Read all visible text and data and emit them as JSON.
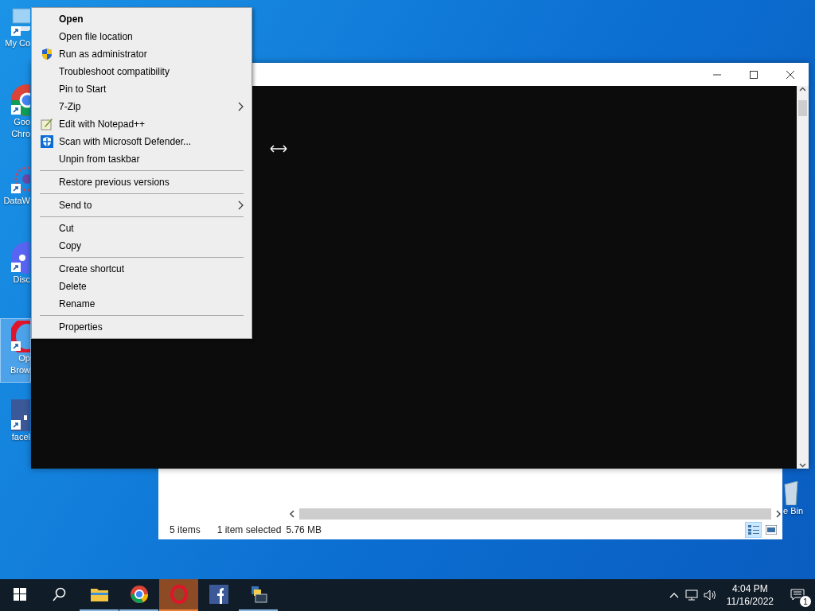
{
  "desktop_icons": [
    {
      "lines": [
        "My Co"
      ],
      "selected": false
    },
    {
      "lines": [
        "Goo",
        "Chro"
      ],
      "selected": false
    },
    {
      "lines": [
        "DataW"
      ],
      "selected": false
    },
    {
      "lines": [
        "Disc"
      ],
      "selected": false
    },
    {
      "lines": [
        "Op",
        "Brow"
      ],
      "selected": true
    },
    {
      "lines": [
        "facel"
      ],
      "selected": false
    }
  ],
  "recycle_bin": {
    "label": "e Bin"
  },
  "context_menu": {
    "items": [
      {
        "kind": "item",
        "label": "Open",
        "default": true,
        "submenu": false
      },
      {
        "kind": "item",
        "label": "Open file location",
        "default": false,
        "submenu": false
      },
      {
        "kind": "item",
        "label": "Run as administrator",
        "default": false,
        "submenu": false
      },
      {
        "kind": "item",
        "label": "Troubleshoot compatibility",
        "default": false,
        "submenu": false
      },
      {
        "kind": "item",
        "label": "Pin to Start",
        "default": false,
        "submenu": false
      },
      {
        "kind": "item",
        "label": "7-Zip",
        "default": false,
        "submenu": true
      },
      {
        "kind": "item",
        "label": "Edit with Notepad++",
        "default": false,
        "submenu": false
      },
      {
        "kind": "item",
        "label": "Scan with Microsoft Defender...",
        "default": false,
        "submenu": false
      },
      {
        "kind": "item",
        "label": "Unpin from taskbar",
        "default": false,
        "submenu": false
      },
      {
        "kind": "separator"
      },
      {
        "kind": "item",
        "label": "Restore previous versions",
        "default": false,
        "submenu": false
      },
      {
        "kind": "separator"
      },
      {
        "kind": "item",
        "label": "Send to",
        "default": false,
        "submenu": true
      },
      {
        "kind": "separator"
      },
      {
        "kind": "item",
        "label": "Cut",
        "default": false,
        "submenu": false
      },
      {
        "kind": "item",
        "label": "Copy",
        "default": false,
        "submenu": false
      },
      {
        "kind": "separator"
      },
      {
        "kind": "item",
        "label": "Create shortcut",
        "default": false,
        "submenu": false
      },
      {
        "kind": "item",
        "label": "Delete",
        "default": false,
        "submenu": false
      },
      {
        "kind": "item",
        "label": "Rename",
        "default": false,
        "submenu": false
      },
      {
        "kind": "separator"
      },
      {
        "kind": "item",
        "label": "Properties",
        "default": false,
        "submenu": false
      }
    ]
  },
  "explorer": {
    "status": [
      "5 items",
      "1 item selected",
      "5.76 MB"
    ],
    "views": [
      {
        "selected": true
      },
      {
        "selected": false
      }
    ]
  },
  "taskbar": {
    "apps": [
      {
        "running": true,
        "selected": false
      },
      {
        "running": true,
        "selected": false
      },
      {
        "running": true,
        "selected": true
      },
      {
        "running": false,
        "selected": false
      },
      {
        "running": true,
        "selected": false
      }
    ],
    "time": "4:04 PM",
    "date": "11/16/2022",
    "notifications": "1"
  }
}
